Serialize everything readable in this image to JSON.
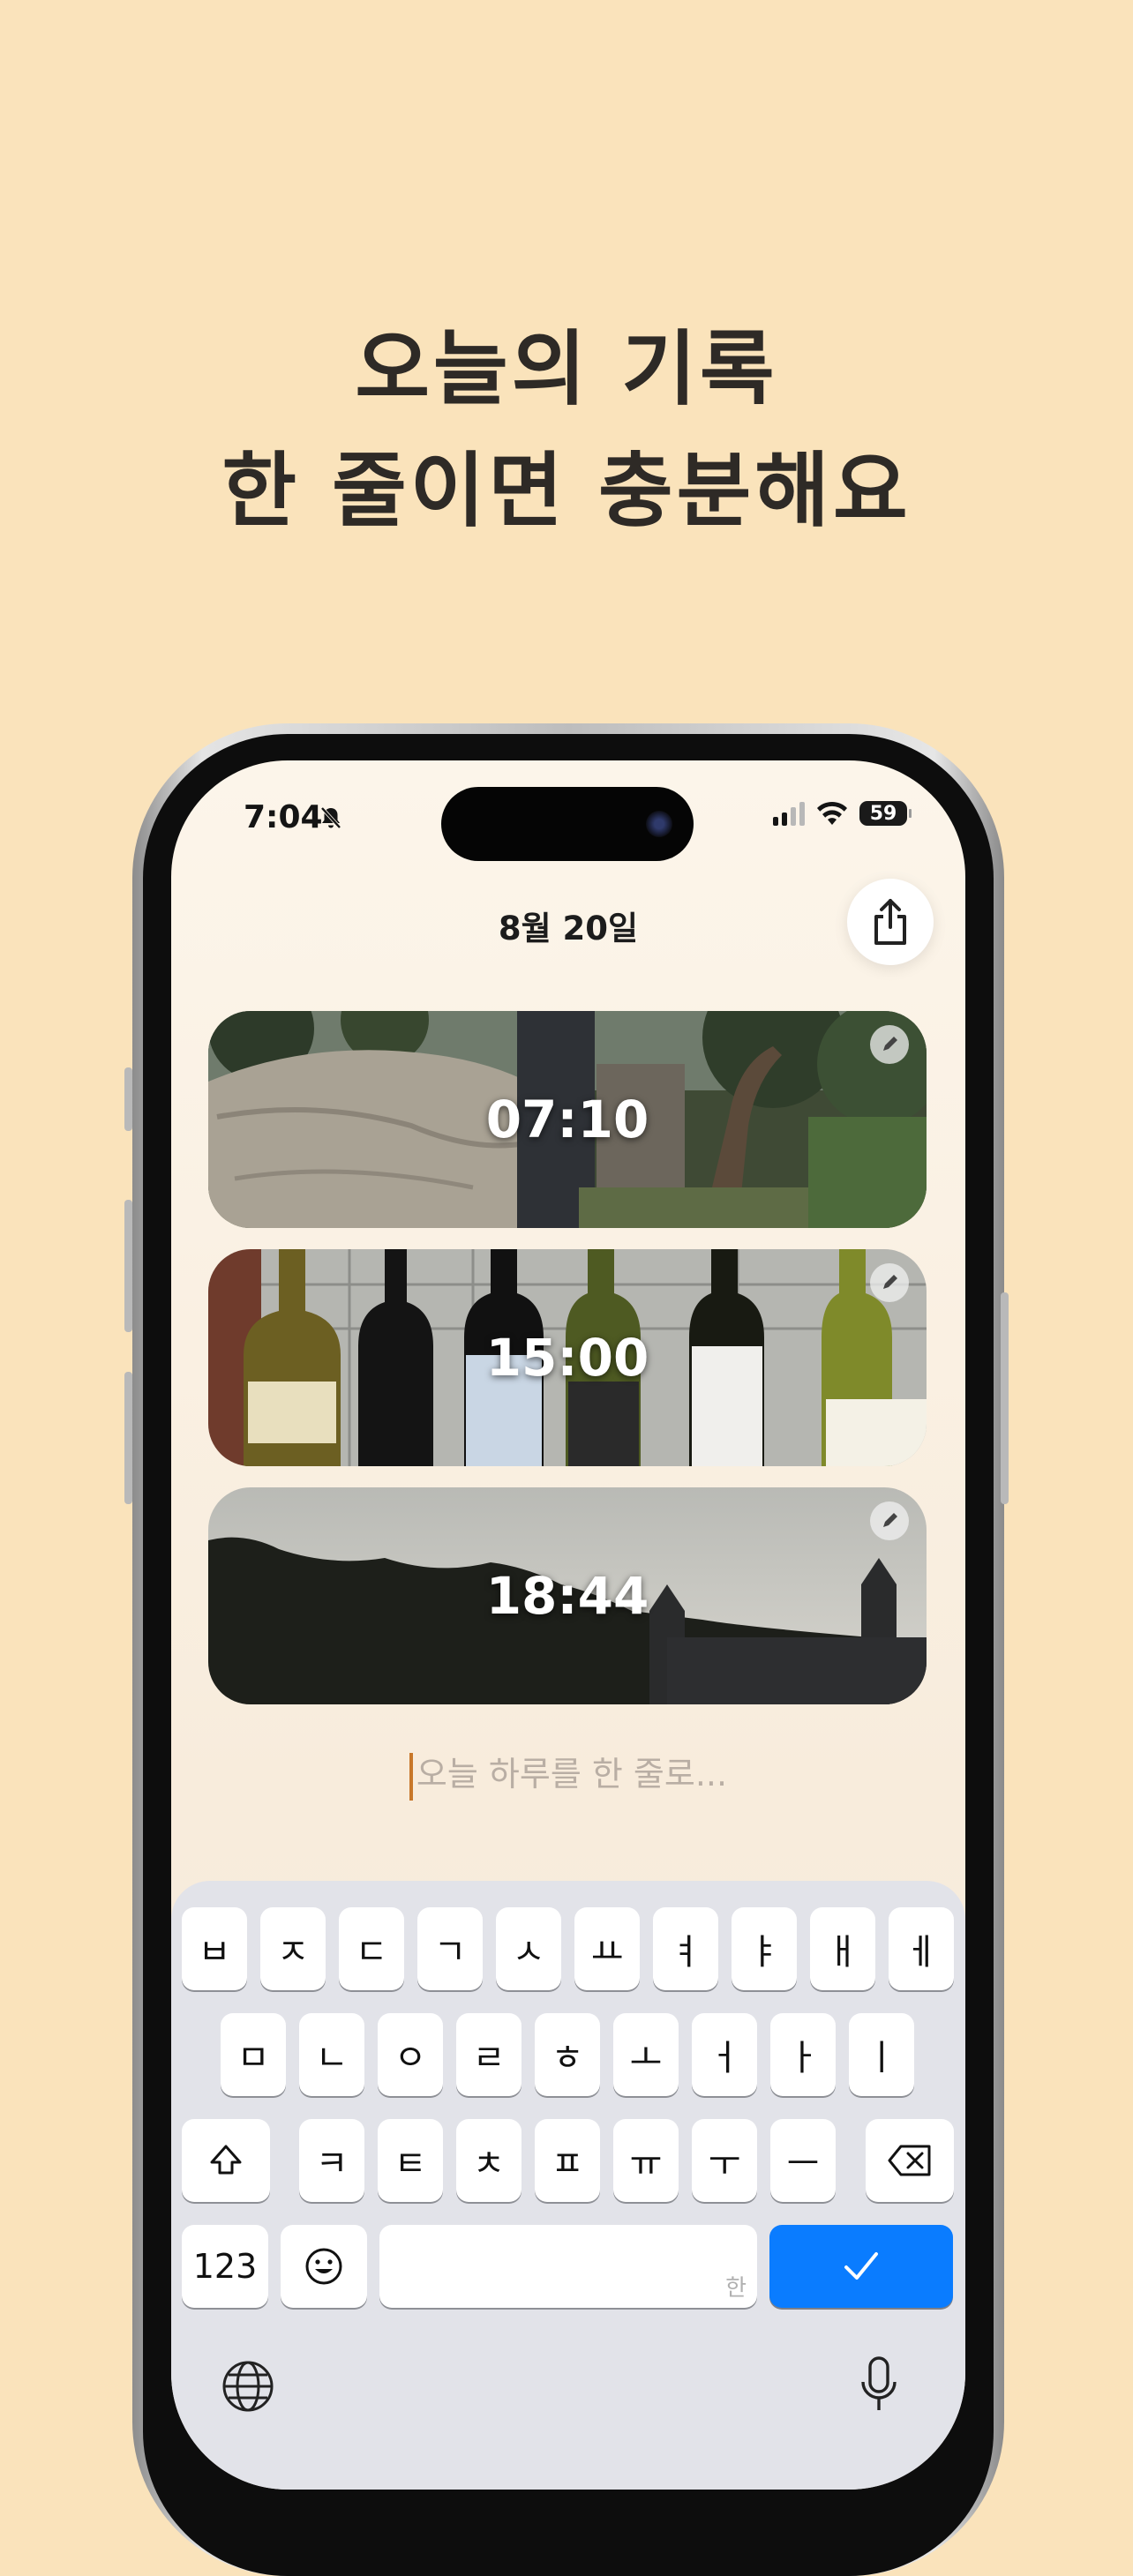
{
  "headline": {
    "line1": "오늘의 기록",
    "line2": "한 줄이면 충분해요"
  },
  "status_bar": {
    "time": "7:04",
    "battery": "59"
  },
  "header": {
    "date": "8월 20일"
  },
  "entries": [
    {
      "time": "07:10"
    },
    {
      "time": "15:00"
    },
    {
      "time": "18:44"
    }
  ],
  "input": {
    "placeholder": "오늘 하루를 한 줄로..."
  },
  "keyboard": {
    "row1": [
      "ㅂ",
      "ㅈ",
      "ㄷ",
      "ㄱ",
      "ㅅ",
      "ㅛ",
      "ㅕ",
      "ㅑ",
      "ㅐ",
      "ㅔ"
    ],
    "row2": [
      "ㅁ",
      "ㄴ",
      "ㅇ",
      "ㄹ",
      "ㅎ",
      "ㅗ",
      "ㅓ",
      "ㅏ",
      "ㅣ"
    ],
    "row3": [
      "ㅋ",
      "ㅌ",
      "ㅊ",
      "ㅍ",
      "ㅠ",
      "ㅜ",
      "ㅡ"
    ],
    "numbers_label": "123",
    "space_hint": "한",
    "return_color": "#0a7cff"
  },
  "colors": {
    "background": "#fae3bb",
    "accent": "#0a7cff"
  }
}
